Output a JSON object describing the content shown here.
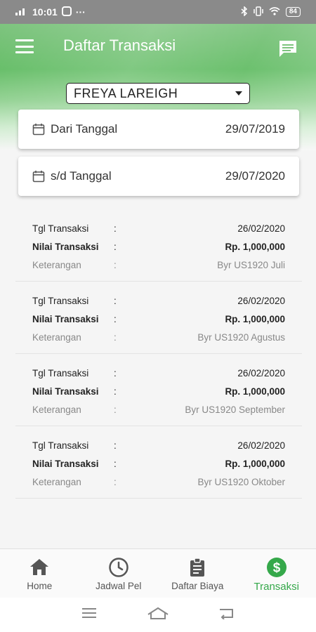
{
  "status": {
    "time": "10:01",
    "battery": "84"
  },
  "app": {
    "title": "Daftar Transaksi"
  },
  "student_select": {
    "selected": "FREYA LAREIGH"
  },
  "date_from": {
    "label": "Dari Tanggal",
    "value": "29/07/2019"
  },
  "date_to": {
    "label": "s/d Tanggal",
    "value": "29/07/2020"
  },
  "transactions": [
    {
      "tgl_label": "Tgl Transaksi",
      "tgl_value": "26/02/2020",
      "nilai_label": "Nilai Transaksi",
      "nilai_value": "Rp. 1,000,000",
      "ket_label": "Keterangan",
      "ket_value": "Byr US1920 Juli",
      "colon": ":"
    },
    {
      "tgl_label": "Tgl Transaksi",
      "tgl_value": "26/02/2020",
      "nilai_label": "Nilai Transaksi",
      "nilai_value": "Rp. 1,000,000",
      "ket_label": "Keterangan",
      "ket_value": "Byr US1920 Agustus",
      "colon": ":"
    },
    {
      "tgl_label": "Tgl Transaksi",
      "tgl_value": "26/02/2020",
      "nilai_label": "Nilai Transaksi",
      "nilai_value": "Rp. 1,000,000",
      "ket_label": "Keterangan",
      "ket_value": "Byr US1920 September",
      "colon": ":"
    },
    {
      "tgl_label": "Tgl Transaksi",
      "tgl_value": "26/02/2020",
      "nilai_label": "Nilai Transaksi",
      "nilai_value": "Rp. 1,000,000",
      "ket_label": "Keterangan",
      "ket_value": "Byr US1920 Oktober",
      "colon": ":"
    }
  ],
  "bottom_nav": {
    "items": [
      {
        "label": "Home",
        "icon": "home-icon"
      },
      {
        "label": "Jadwal Pel",
        "icon": "clock-icon"
      },
      {
        "label": "Daftar Biaya",
        "icon": "clipboard-icon"
      },
      {
        "label": "Transaksi",
        "icon": "dollar-icon",
        "active": true
      }
    ]
  },
  "colors": {
    "brand_green": "#64bd66",
    "active_green": "#35a84a"
  }
}
